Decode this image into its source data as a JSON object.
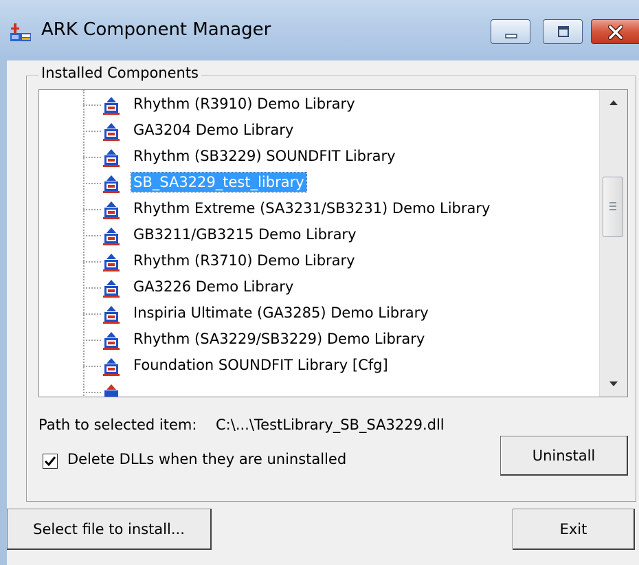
{
  "window": {
    "title": "ARK Component Manager",
    "icon": "ark-app-icon"
  },
  "group": {
    "label": "Installed Components"
  },
  "tree": {
    "items": [
      {
        "label": "Rhythm (R3910) Demo Library",
        "icon": "library-icon",
        "selected": false
      },
      {
        "label": "GA3204 Demo Library",
        "icon": "library-icon",
        "selected": false
      },
      {
        "label": "Rhythm (SB3229) SOUNDFIT Library",
        "icon": "library-icon",
        "selected": false
      },
      {
        "label": "SB_SA3229_test_library",
        "icon": "library-icon",
        "selected": true
      },
      {
        "label": "Rhythm Extreme (SA3231/SB3231) Demo Library",
        "icon": "library-icon",
        "selected": false
      },
      {
        "label": "GB3211/GB3215 Demo Library",
        "icon": "library-icon",
        "selected": false
      },
      {
        "label": "Rhythm (R3710) Demo Library",
        "icon": "library-icon",
        "selected": false
      },
      {
        "label": "GA3226 Demo Library",
        "icon": "library-icon",
        "selected": false
      },
      {
        "label": "Inspiria Ultimate (GA3285) Demo Library",
        "icon": "library-icon",
        "selected": false
      },
      {
        "label": "Rhythm (SA3229/SB3229) Demo Library",
        "icon": "library-icon",
        "selected": false
      },
      {
        "label": "Foundation SOUNDFIT Library [Cfg]",
        "icon": "library-icon",
        "selected": false
      }
    ]
  },
  "path": {
    "label": "Path to selected item:",
    "value": "C:\\...\\TestLibrary_SB_SA3229.dll"
  },
  "delete_dlls": {
    "label": "Delete DLLs when they are uninstalled",
    "checked": true
  },
  "buttons": {
    "uninstall": "Uninstall",
    "select_file": "Select file to install...",
    "exit": "Exit"
  },
  "colors": {
    "selection": "#3399ff",
    "titlebar": "#b5cde8",
    "close_button": "#c2381f",
    "library_icon": "#1f4fc4"
  }
}
